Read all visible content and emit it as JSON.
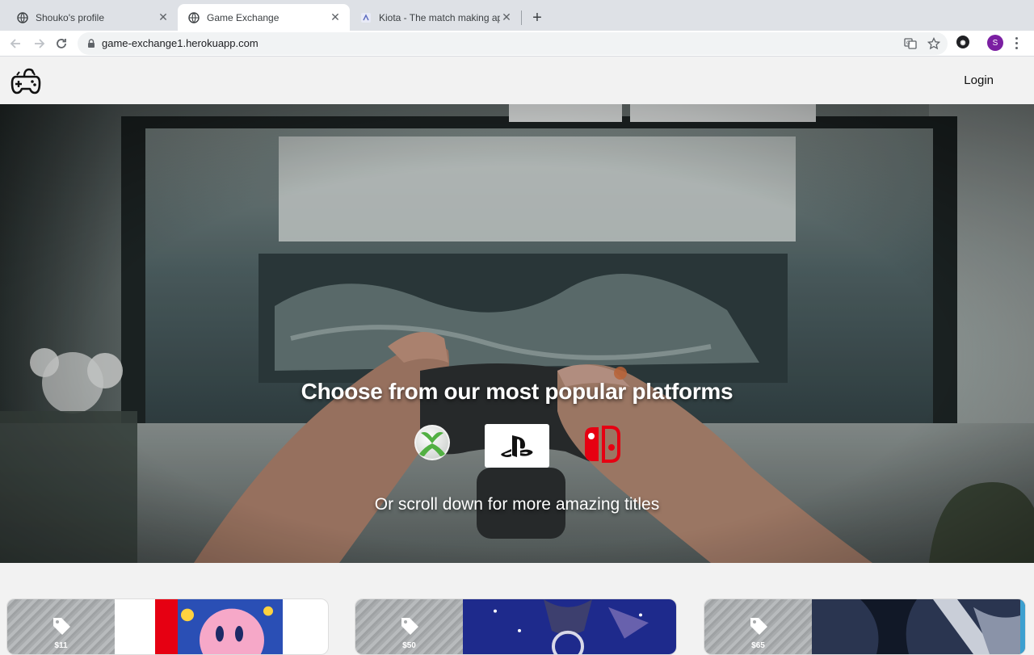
{
  "browser": {
    "tabs": [
      {
        "title": "Shouko's profile",
        "active": false
      },
      {
        "title": "Game Exchange",
        "active": true
      },
      {
        "title": "Kiota - The match making app",
        "active": false
      }
    ],
    "url": "game-exchange1.herokuapp.com",
    "profile_initial": "S",
    "profile_color": "#7b1fa2"
  },
  "header": {
    "login_label": "Login"
  },
  "hero": {
    "title": "Choose from our most popular platforms",
    "subtitle": "Or scroll down for more amazing titles",
    "platforms": [
      "xbox",
      "playstation",
      "nintendo-switch"
    ]
  },
  "cards": [
    {
      "price": "$11",
      "cover": "kirby-switch-cover"
    },
    {
      "price": "$50",
      "cover": "kingdom-hearts-cover"
    },
    {
      "price": "$65",
      "cover": "bayonetta-cover"
    }
  ],
  "colors": {
    "switch_red": "#e60012",
    "xbox_green": "#52b043",
    "chrome_bg": "#dee1e6"
  }
}
